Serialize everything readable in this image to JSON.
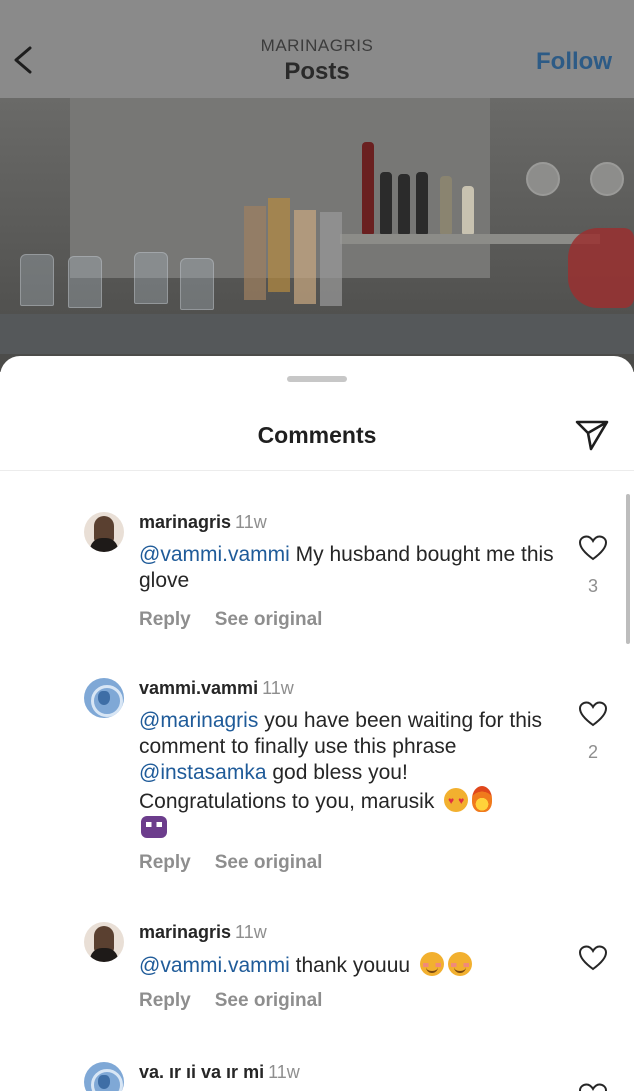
{
  "header": {
    "username": "MARINAGRIS",
    "title": "Posts",
    "follow_label": "Follow",
    "back_icon": "chevron-left-icon"
  },
  "sheet": {
    "title": "Comments",
    "share_icon": "paper-plane-icon"
  },
  "comments": [
    {
      "username": "marinagris",
      "time": "11w",
      "mention": "@vammi.vammi",
      "text": "My husband bought me this glove",
      "reply_label": "Reply",
      "see_original_label": "See original",
      "likes": "3"
    },
    {
      "username": "vammi.vammi",
      "time": "11w",
      "mention": "@marinagris",
      "text_1": "you have been waiting for this comment to finally use this phrase",
      "mention_2": "@instasamka",
      "text_2": "god bless you! Congratulations to you, marusik",
      "emojis": [
        "smiling-face-with-heart-eyes",
        "fire",
        "alien-monster"
      ],
      "reply_label": "Reply",
      "see_original_label": "See original",
      "likes": "2"
    },
    {
      "username": "marinagris",
      "time": "11w",
      "mention": "@vammi.vammi",
      "text": "thank youuu",
      "emojis": [
        "smiling-face",
        "smiling-face"
      ],
      "reply_label": "Reply",
      "see_original_label": "See original"
    },
    {
      "username": "va. ır ıi va ır mi",
      "time": "11w"
    }
  ],
  "colors": {
    "mention": "#1f5b99",
    "follow": "#2d5b86",
    "secondary_text": "#8e8e8e"
  }
}
